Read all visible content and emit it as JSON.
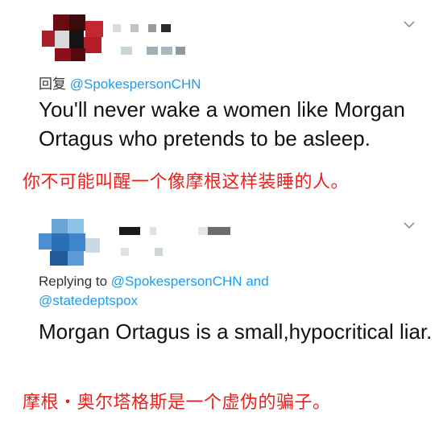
{
  "tweets": [
    {
      "reply_prefix": "回复",
      "reply_handle": "@SpokespersonCHN",
      "text": "You'll never wake a women like Morgan Ortagus who pretends to be asleep.",
      "translation": "你不可能叫醒一个像摩根这样装睡的人。"
    },
    {
      "reply_prefix": "Replying to",
      "reply_handle": "@SpokespersonCHN",
      "reply_joiner": "and",
      "reply_handle2": "@statedeptspox",
      "text": "Morgan Ortagus is a small,hypocritical liar.",
      "translation": "摩根・奥尔塔格斯是一个虚伪的骗子。"
    }
  ],
  "icons": {
    "menu": "chevron-down-icon",
    "avatar": "pixelated-avatar"
  },
  "colors": {
    "link": "#1d9bf0",
    "annotation": "#e8201e",
    "text": "#111111"
  }
}
